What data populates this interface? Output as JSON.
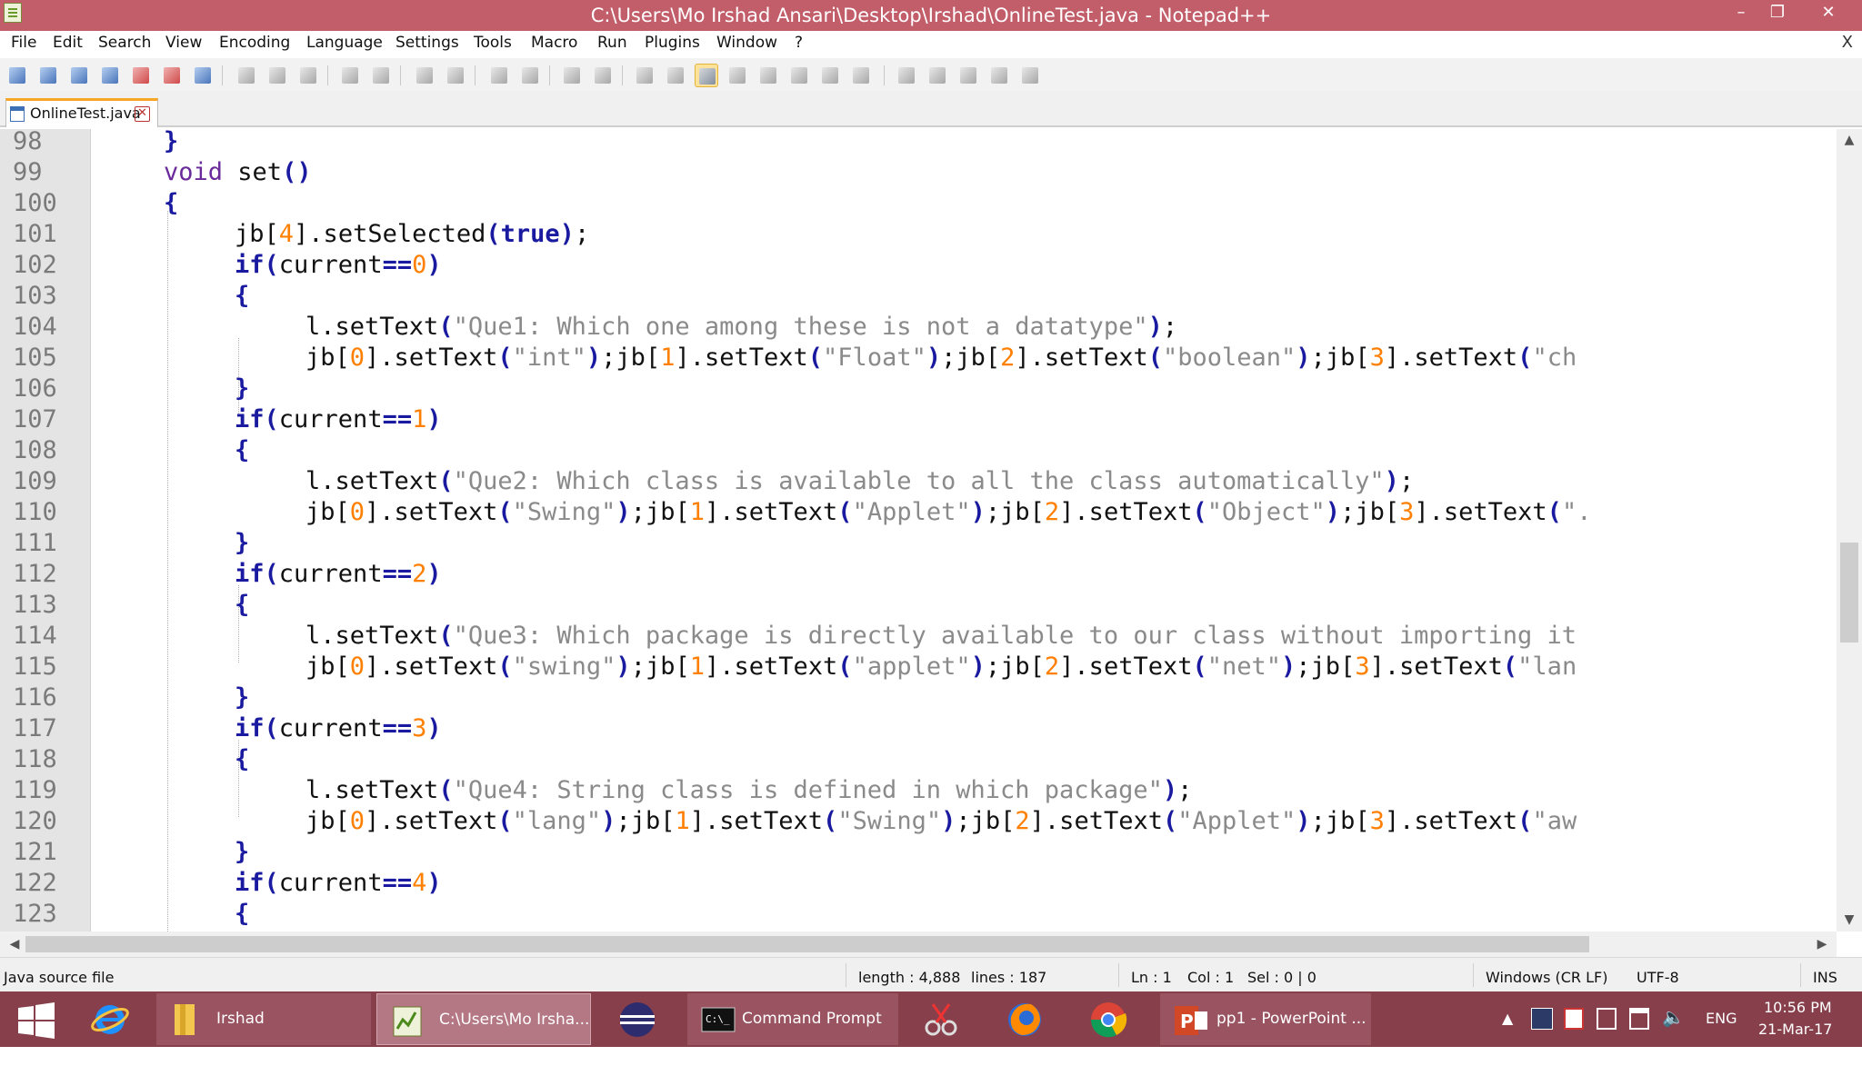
{
  "window": {
    "title": "C:\\Users\\Mo Irshad Ansari\\Desktop\\Irshad\\OnlineTest.java - Notepad++",
    "controls": {
      "minimize": "–",
      "restore": "❐",
      "close": "✕"
    }
  },
  "menu": {
    "items": [
      "File",
      "Edit",
      "Search",
      "View",
      "Encoding",
      "Language",
      "Settings",
      "Tools",
      "Macro",
      "Run",
      "Plugins",
      "Window",
      "?"
    ],
    "close_doc": "X"
  },
  "tab": {
    "label": "OnlineTest.java",
    "close": "✕"
  },
  "editor": {
    "lines": [
      {
        "n": "98"
      },
      {
        "n": "99"
      },
      {
        "n": "100"
      },
      {
        "n": "101"
      },
      {
        "n": "102"
      },
      {
        "n": "103"
      },
      {
        "n": "104"
      },
      {
        "n": "105"
      },
      {
        "n": "106"
      },
      {
        "n": "107"
      },
      {
        "n": "108"
      },
      {
        "n": "109"
      },
      {
        "n": "110"
      },
      {
        "n": "111"
      },
      {
        "n": "112"
      },
      {
        "n": "113"
      },
      {
        "n": "114"
      },
      {
        "n": "115"
      },
      {
        "n": "116"
      },
      {
        "n": "117"
      },
      {
        "n": "118"
      },
      {
        "n": "119"
      },
      {
        "n": "120"
      },
      {
        "n": "121"
      },
      {
        "n": "122"
      },
      {
        "n": "123"
      }
    ],
    "code": {
      "l98": "}",
      "l99_kw": "void",
      "l99_rest": " set",
      "l99_parens": "()",
      "l100": "{",
      "l101_a": "jb[",
      "l101_num": "4",
      "l101_b": "].setSelected",
      "l101_kw": "true",
      "l101_c": ";",
      "if_kw": "if",
      "cond_var": "current",
      "cond_op": "==",
      "n0": "0",
      "n1": "1",
      "n2": "2",
      "n3": "3",
      "n4": "4",
      "open": "{",
      "close": "}",
      "settext_l": "l.setText",
      "q1": "\"Que1: Which one among these is not a datatype\"",
      "q2": "\"Que2: Which class is available to all the class automatically\"",
      "q3": "\"Que3: Which package is directly available to our class without importing it",
      "q4": "\"Que4: String class is defined in which package\"",
      "l105": "\"int\"|\"Float\"|\"boolean\"|\"ch",
      "jb_settext": "].setText",
      "s105": [
        "\"int\"",
        "\"Float\"",
        "\"boolean\"",
        "\"ch"
      ],
      "s110": [
        "\"Swing\"",
        "\"Applet\"",
        "\"Object\"",
        "\"."
      ],
      "s115": [
        "\"swing\"",
        "\"applet\"",
        "\"net\"",
        "\"lan"
      ],
      "s120": [
        "\"lang\"",
        "\"Swing\"",
        "\"Applet\"",
        "\"aw"
      ]
    }
  },
  "status": {
    "file_type": "Java source file",
    "length": "length : 4,888",
    "lines": "lines : 187",
    "ln": "Ln : 1",
    "col": "Col : 1",
    "sel": "Sel : 0 | 0",
    "eol": "Windows (CR LF)",
    "encoding": "UTF-8",
    "mode": "INS"
  },
  "taskbar": {
    "folder": "Irshad",
    "notepad": "C:\\Users\\Mo Irsha...",
    "cmd": "Command Prompt",
    "ppt": "pp1 - PowerPoint ...",
    "lang": "ENG",
    "time": "10:56 PM",
    "date": "21-Mar-17"
  }
}
